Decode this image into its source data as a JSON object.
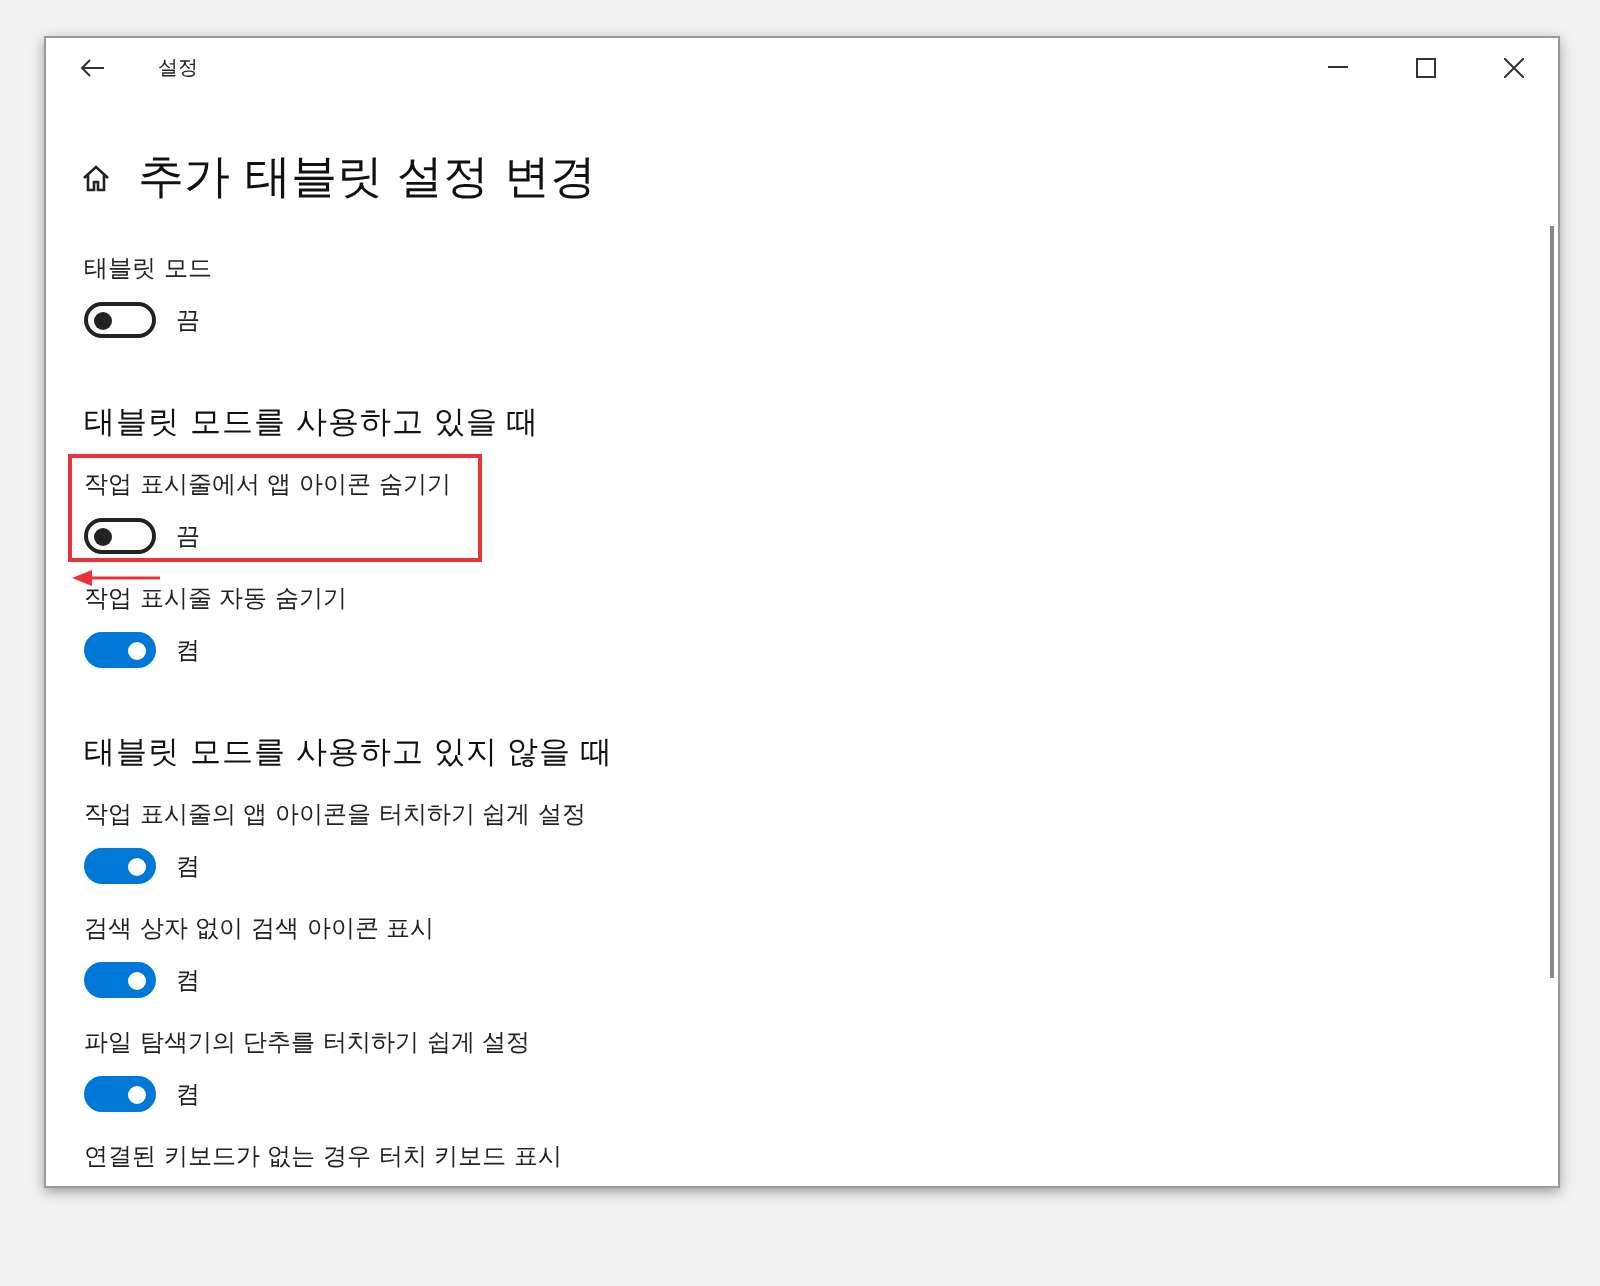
{
  "window": {
    "title": "설정"
  },
  "page_title": "추가 태블릿 설정 변경",
  "items": [
    {
      "kind": "toggle",
      "label": "태블릿 모드",
      "on": false,
      "state_text": "끔",
      "highlighted": false
    },
    {
      "kind": "heading",
      "text": "태블릿 모드를 사용하고 있을 때"
    },
    {
      "kind": "toggle",
      "label": "작업 표시줄에서 앱 아이콘 숨기기",
      "on": false,
      "state_text": "끔",
      "highlighted": true
    },
    {
      "kind": "toggle",
      "label": "작업 표시줄 자동 숨기기",
      "on": true,
      "state_text": "켬",
      "highlighted": false
    },
    {
      "kind": "heading",
      "text": "태블릿 모드를 사용하고 있지 않을 때"
    },
    {
      "kind": "toggle",
      "label": "작업 표시줄의 앱 아이콘을 터치하기 쉽게 설정",
      "on": true,
      "state_text": "켬",
      "highlighted": false
    },
    {
      "kind": "toggle",
      "label": "검색 상자 없이 검색 아이콘 표시",
      "on": true,
      "state_text": "켬",
      "highlighted": false
    },
    {
      "kind": "toggle",
      "label": "파일 탐색기의 단추를 터치하기 쉽게 설정",
      "on": true,
      "state_text": "켬",
      "highlighted": false
    },
    {
      "kind": "label",
      "text": "연결된 키보드가 없는 경우 터치 키보드 표시"
    }
  ]
}
